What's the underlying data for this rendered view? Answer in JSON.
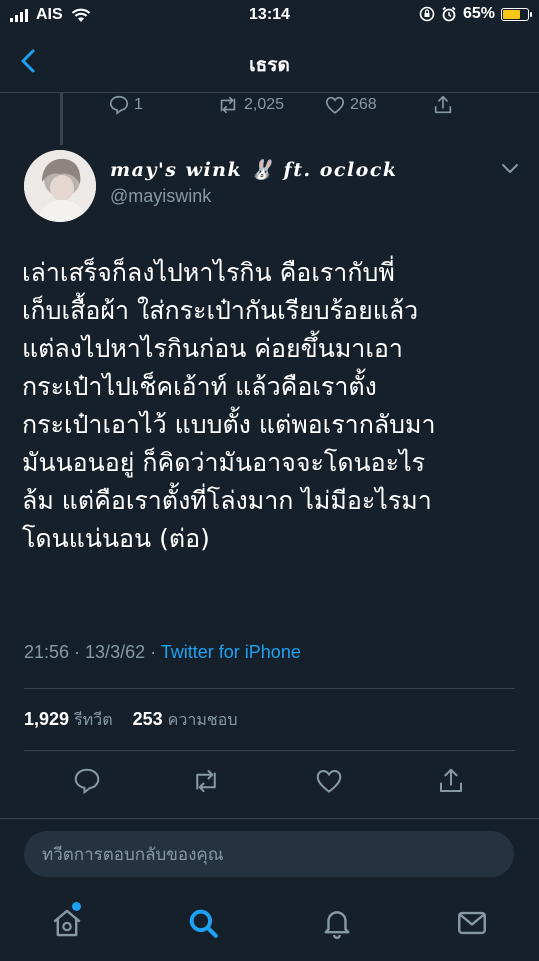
{
  "status_bar": {
    "carrier": "AIS",
    "time": "13:14",
    "battery": "65%",
    "battery_level": 0.65
  },
  "nav": {
    "title": "เธรด"
  },
  "previous_tweet": {
    "replies": "1",
    "retweets": "2,025",
    "likes": "268"
  },
  "tweet": {
    "display_name": "may's wink 🐰 ft. oclock",
    "handle": "@mayiswink",
    "text": "เล่าเสร็จก็ลงไปหาไรกิน คือเรากับพี่\nเก็บเสื้อผ้า ใส่กระเป๋ากันเรียบร้อยแล้ว\nแต่ลงไปหาไรกินก่อน ค่อยขึ้นมาเอา\nกระเป๋าไปเช็คเอ้าท์ แล้วคือเราตั้ง\nกระเป๋าเอาไว้ แบบตั้ง แต่พอเรากลับมา\nมันนอนอยู่ ก็คิดว่ามันอาจจะโดนอะไร\nล้ม แต่คือเราตั้งที่โล่งมาก ไม่มีอะไรมา\nโดนแน่นอน (ต่อ)",
    "time_date": "21:56 · 13/3/62 · ",
    "source": "Twitter for iPhone",
    "retweet_count": "1,929",
    "retweet_label": "รีทวีต",
    "like_count": "253",
    "like_label": "ความชอบ"
  },
  "reply": {
    "placeholder": "ทวีตการตอบกลับของคุณ"
  },
  "colors": {
    "background": "#15202b",
    "accent": "#1da1f2",
    "muted": "#8899a6",
    "divider": "#38444d"
  },
  "icons": {
    "actions": [
      "reply-icon",
      "retweet-icon",
      "like-icon",
      "share-icon"
    ],
    "tabs": [
      "home-icon",
      "search-icon",
      "notifications-icon",
      "messages-icon"
    ]
  }
}
